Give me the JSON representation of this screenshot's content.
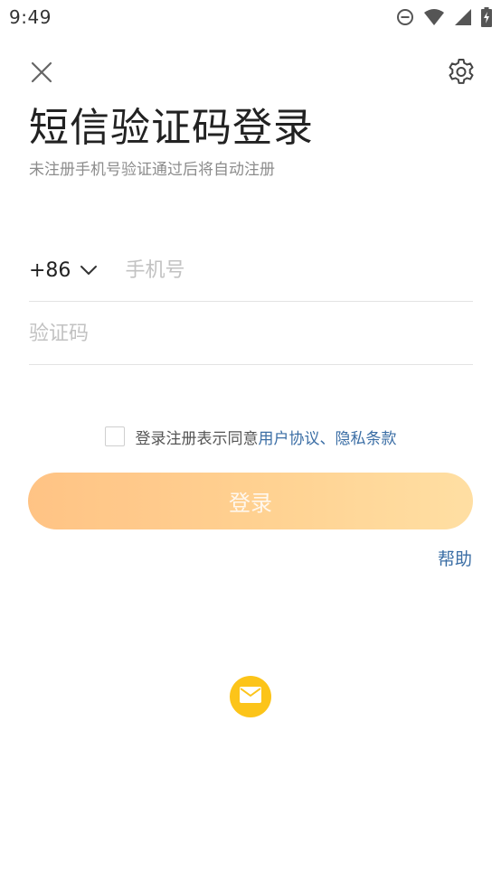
{
  "status_bar": {
    "time": "9:49",
    "icons": [
      "do-not-disturb-icon",
      "wifi-icon",
      "signal-icon",
      "battery-charging-icon"
    ]
  },
  "header": {
    "close_icon": "close-icon",
    "settings_icon": "gear-icon"
  },
  "title": "短信验证码登录",
  "subtitle": "未注册手机号验证通过后将自动注册",
  "phone": {
    "country_code": "+86",
    "dropdown_icon": "chevron-down-icon",
    "placeholder": "手机号",
    "value": ""
  },
  "code": {
    "placeholder": "验证码",
    "value": ""
  },
  "agreement": {
    "checked": false,
    "prefix": "登录注册表示同意",
    "user_agreement": "用户协议",
    "separator": "、",
    "privacy_policy": "隐私条款"
  },
  "login_button": {
    "label": "登录"
  },
  "help_label": "帮助",
  "alt_login": {
    "mail_icon": "mail-icon"
  },
  "colors": {
    "accent_link": "#3b6ea5",
    "button_gradient_start": "#ffc07e",
    "button_gradient_end": "#ffdd9e",
    "mail_button": "#fcc419"
  }
}
